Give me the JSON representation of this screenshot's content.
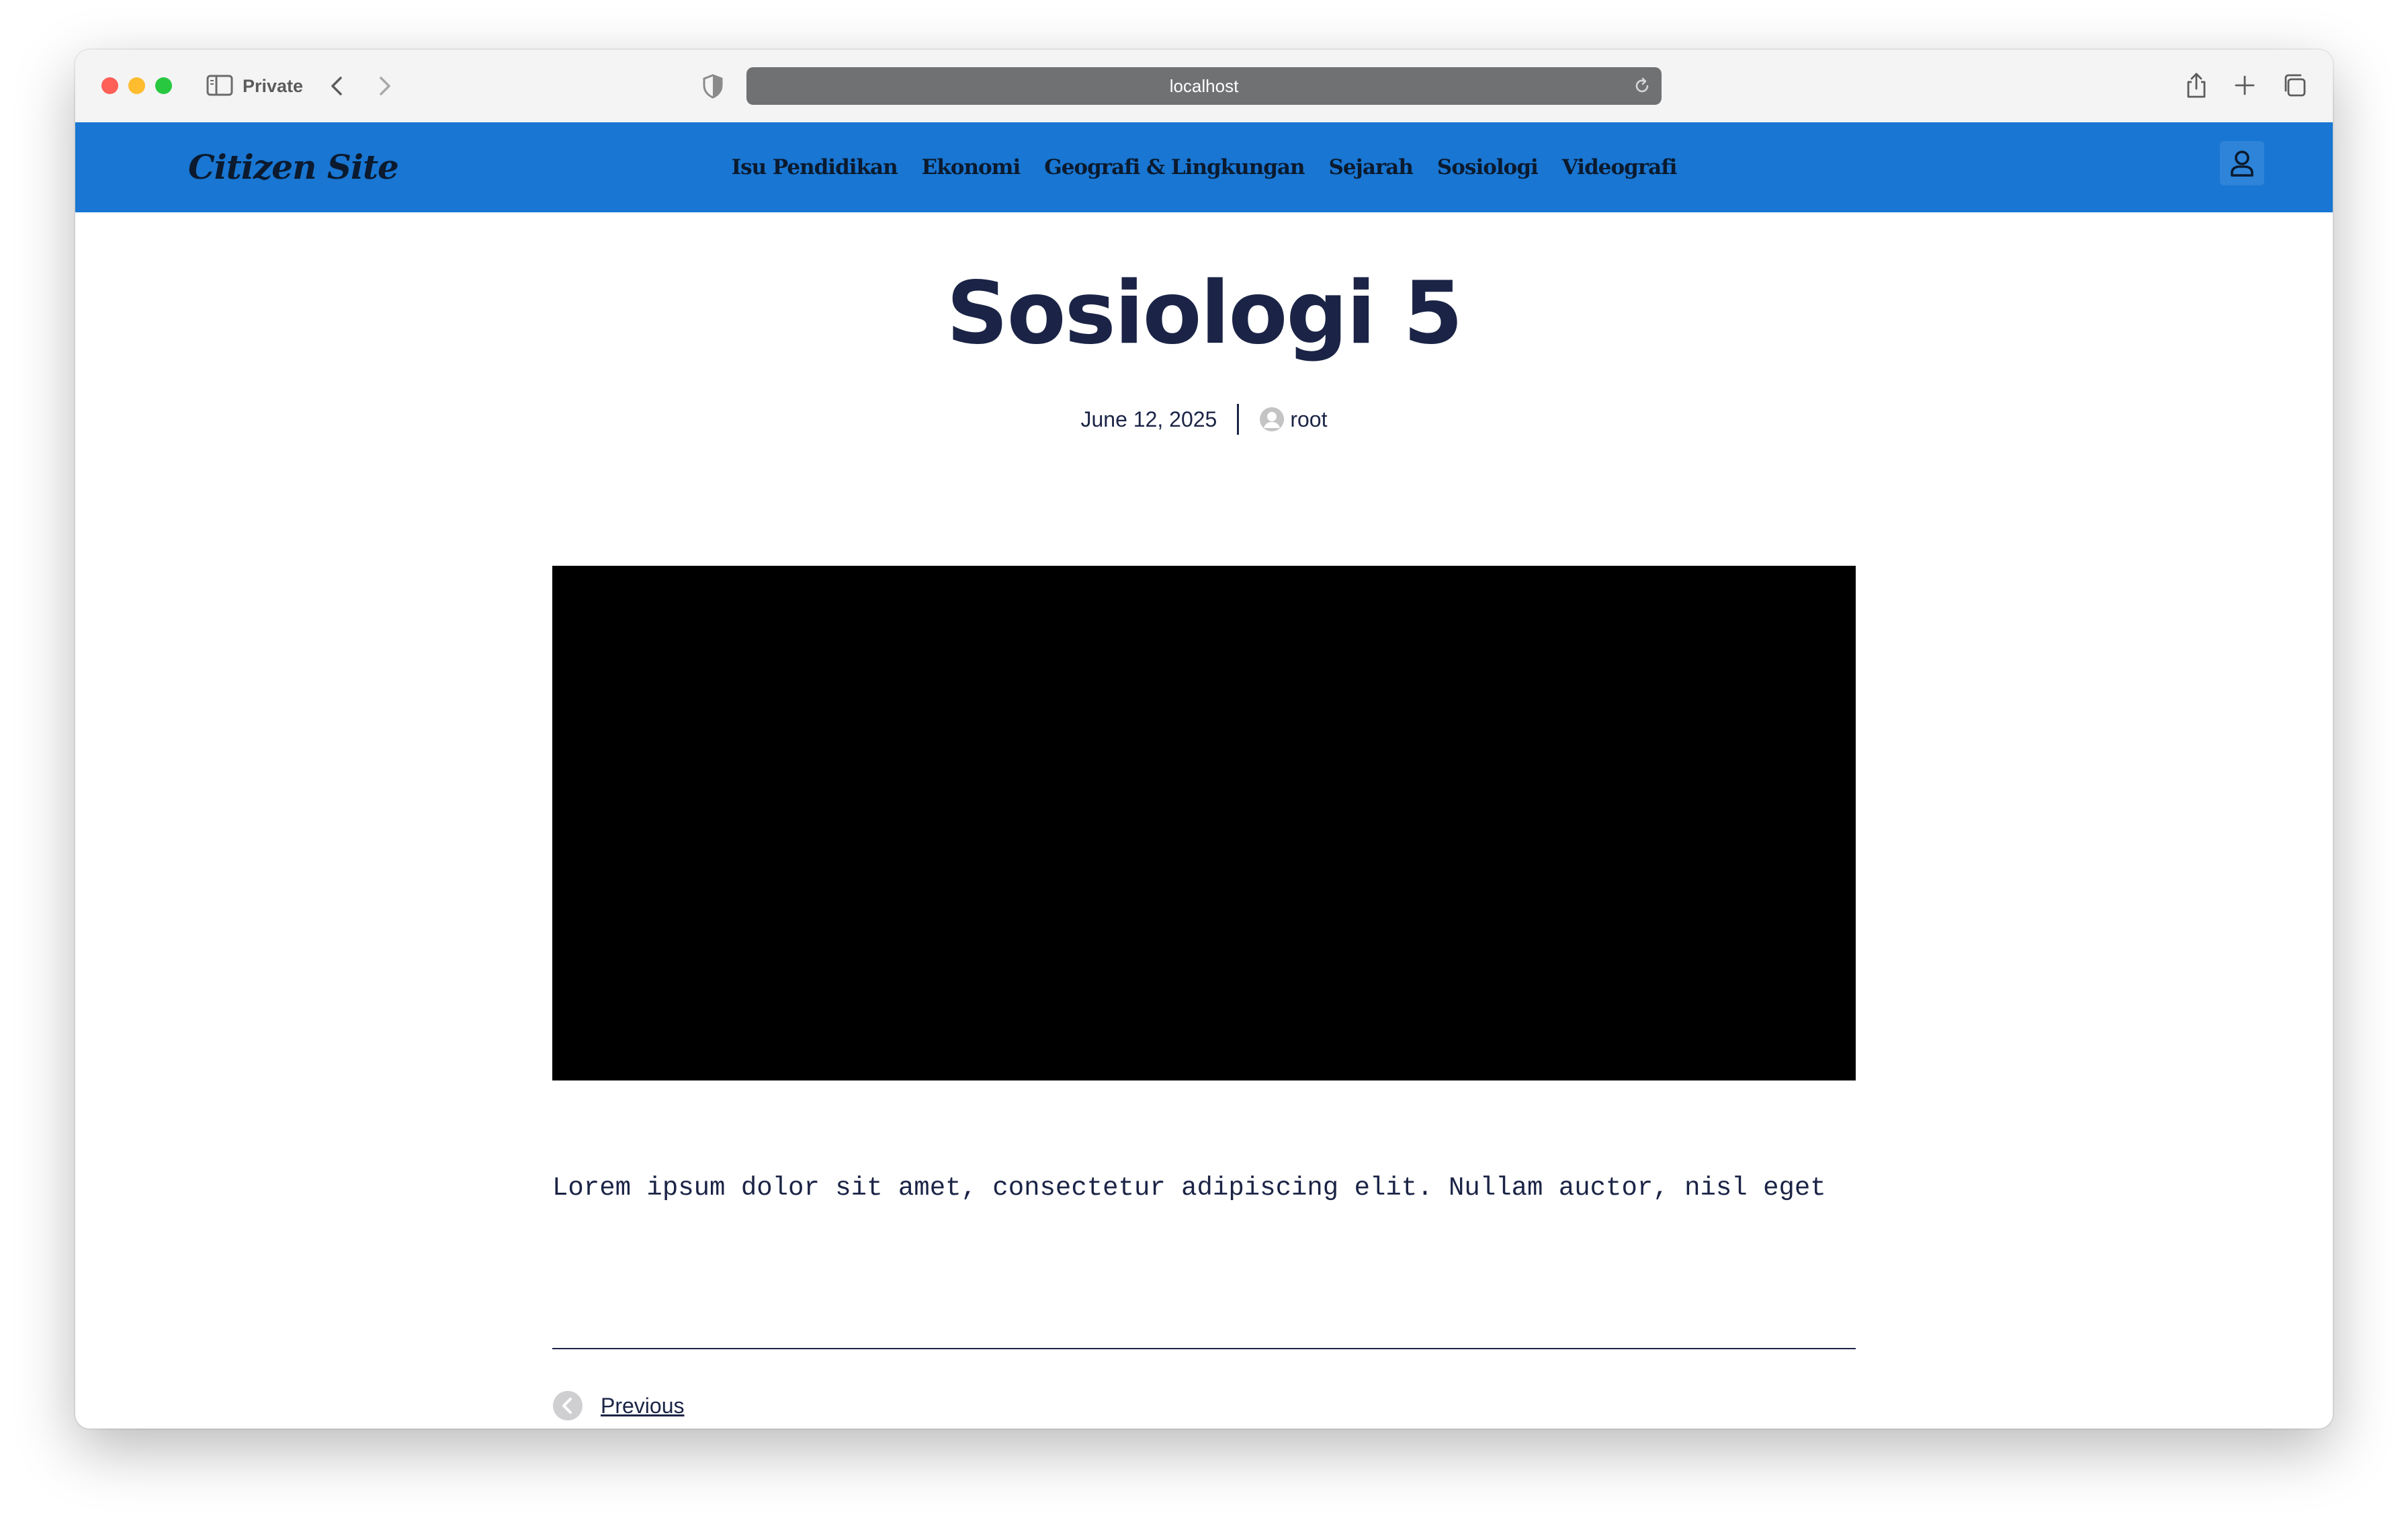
{
  "browser": {
    "mode_label": "Private",
    "url": "localhost"
  },
  "site": {
    "title": "Citizen Site",
    "nav": [
      {
        "label": "Isu Pendidikan"
      },
      {
        "label": "Ekonomi"
      },
      {
        "label": "Geografi & Lingkungan"
      },
      {
        "label": "Sejarah"
      },
      {
        "label": "Sosiologi"
      },
      {
        "label": "Videografi"
      }
    ],
    "header_color": "#1976d2"
  },
  "post": {
    "title": "Sosiologi 5",
    "date": "June 12, 2025",
    "author": "root",
    "body": "Lorem ipsum dolor sit amet, consectetur adipiscing elit. Nullam auctor, nisl eget",
    "previous_label": "Previous"
  },
  "icons": {
    "sidebar": "sidebar-icon",
    "back": "chevron-left-icon",
    "forward": "chevron-right-icon",
    "shield": "shield-icon",
    "reload": "reload-icon",
    "share": "share-icon",
    "new_tab": "plus-icon",
    "tabs": "tabs-overview-icon",
    "account": "user-icon",
    "author": "avatar-icon",
    "previous": "chevron-left-circle-icon"
  },
  "colors": {
    "text_dark": "#1b2446",
    "window_close": "#fe5f57",
    "window_minimize": "#febc2e",
    "window_zoom": "#28c840"
  }
}
